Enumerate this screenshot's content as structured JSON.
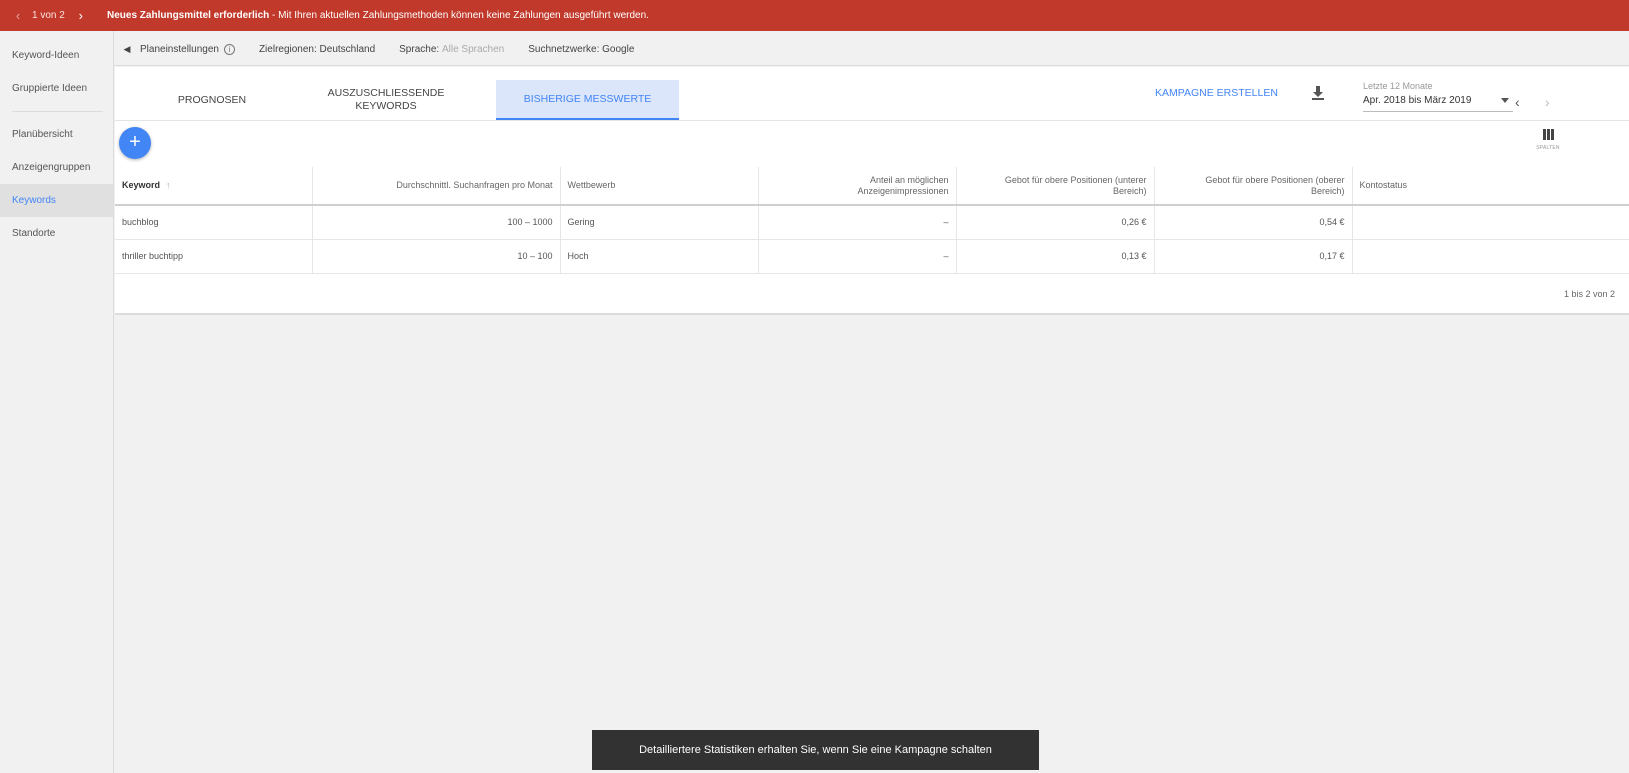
{
  "alert": {
    "counter": "1 von 2",
    "title": "Neues Zahlungsmittel erforderlich",
    "message": " - Mit Ihren aktuellen Zahlungsmethoden können keine Zahlungen ausgeführt werden."
  },
  "leftnav": {
    "group1": [
      "Keyword-Ideen",
      "Gruppierte Ideen"
    ],
    "group2": [
      "Planübersicht",
      "Anzeigengruppen",
      "Keywords",
      "Standorte"
    ],
    "active": "Keywords"
  },
  "settings": {
    "plan_settings": "Planeinstellungen",
    "regions_label": "Zielregionen:",
    "regions_value": "Deutschland",
    "language_label": "Sprache:",
    "language_value": "Alle Sprachen",
    "networks_label": "Suchnetzwerke:",
    "networks_value": "Google"
  },
  "tabs": {
    "forecast": "PROGNOSEN",
    "negative_line1": "AUSZUSCHLIEßENDE",
    "negative_line2": "KEYWORDS",
    "historical": "BISHERIGE MESSWERTE"
  },
  "toolbar": {
    "create_campaign": "KAMPAGNE ERSTELLEN",
    "date_label": "Letzte 12 Monate",
    "date_value": "Apr. 2018 bis März 2019",
    "columns_label": "SPALTEN"
  },
  "table": {
    "headers": {
      "keyword": "Keyword",
      "avg_searches": "Durchschnittl. Suchanfragen pro Monat",
      "competition": "Wettbewerb",
      "impr_share_line1": "Anteil an möglichen",
      "impr_share_line2": "Anzeigenimpressionen",
      "bid_low_line1": "Gebot für obere Positionen (unterer",
      "bid_low_line2": "Bereich)",
      "bid_high_line1": "Gebot für obere Positionen (oberer",
      "bid_high_line2": "Bereich)",
      "account_status": "Kontostatus"
    },
    "rows": [
      {
        "keyword": "buchblog",
        "avg_searches": "100 – 1000",
        "competition": "Gering",
        "impr_share": "–",
        "bid_low": "0,26 €",
        "bid_high": "0,54 €",
        "account_status": ""
      },
      {
        "keyword": "thriller buchtipp",
        "avg_searches": "10 – 100",
        "competition": "Hoch",
        "impr_share": "–",
        "bid_low": "0,13 €",
        "bid_high": "0,17 €",
        "account_status": ""
      }
    ],
    "pagination": "1 bis 2 von 2"
  },
  "snackbar": "Detailliertere Statistiken erhalten Sie, wenn Sie eine Kampagne schalten",
  "colors": {
    "alert_bg": "#c0392b",
    "accent": "#4285f4",
    "active_tab_bg": "#dbe6fb",
    "snackbar_bg": "#323232"
  }
}
